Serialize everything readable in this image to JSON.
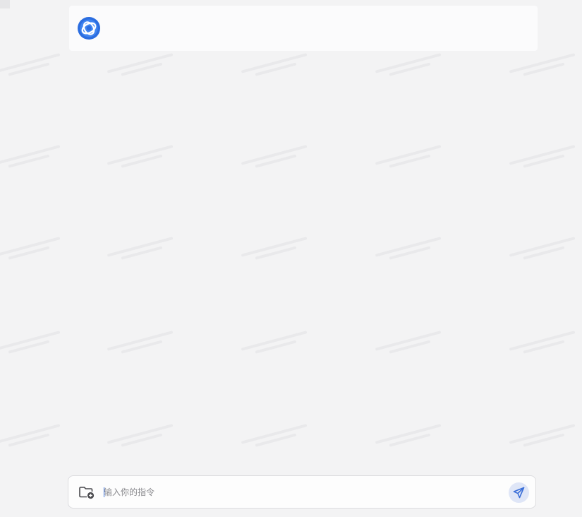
{
  "assistant": {
    "avatar_icon": "assistant-logo-icon",
    "avatar_color": "#2b6de0"
  },
  "composer": {
    "placeholder": "输入你的指令",
    "value": "",
    "attach_icon": "folder-add-icon",
    "send_icon": "send-paper-plane-icon",
    "send_color": "#3b6fd8"
  },
  "colors": {
    "background": "#f3f3f4",
    "card": "#fbfbfc",
    "border": "#dcdcdf"
  }
}
